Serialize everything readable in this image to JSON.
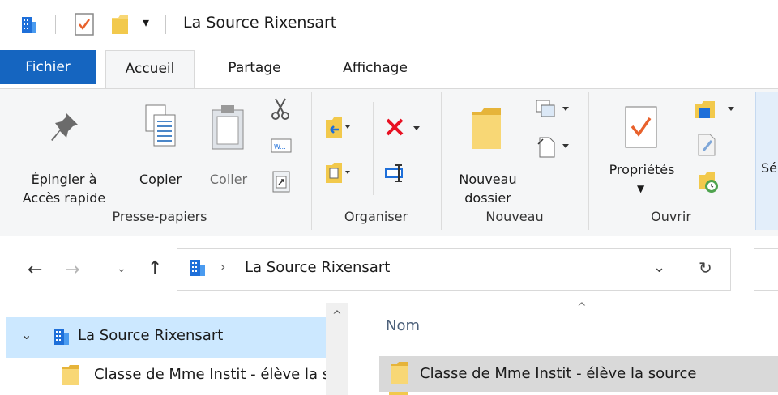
{
  "window": {
    "title": "La Source Rixensart"
  },
  "ribbon_tabs": [
    "Fichier",
    "Accueil",
    "Partage",
    "Affichage"
  ],
  "ribbon": {
    "clipboard": {
      "pin_line1": "Épingler à",
      "pin_line2": "Accès rapide",
      "copy": "Copier",
      "paste": "Coller",
      "group": "Presse-papiers"
    },
    "organize": {
      "group": "Organiser"
    },
    "new": {
      "folder_line1": "Nouveau",
      "folder_line2": "dossier",
      "group": "Nouveau"
    },
    "open": {
      "properties": "Propriétés",
      "group": "Ouvrir",
      "select_partial": "Sé"
    }
  },
  "address": {
    "path": "La Source Rixensart"
  },
  "nav_pane": {
    "root": "La Source Rixensart",
    "child": "Classe de Mme Instit - élève la source"
  },
  "content": {
    "column_name": "Nom",
    "rows": [
      "Classe de Mme Instit - élève la source"
    ]
  },
  "colors": {
    "file_tab": "#1565c0",
    "selection": "#cce8ff",
    "folder": "#f8d775",
    "red_x": "#e81123",
    "check": "#e8612c"
  }
}
